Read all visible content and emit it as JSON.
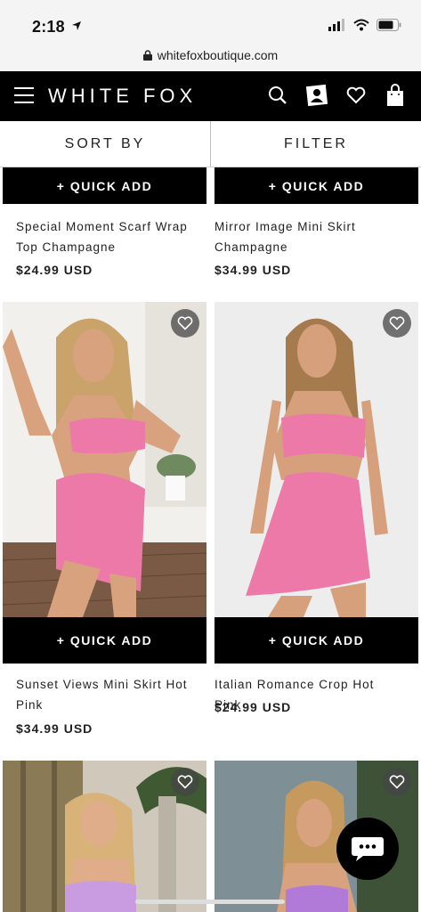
{
  "status": {
    "time": "2:18"
  },
  "browser": {
    "url": "whitefoxboutique.com"
  },
  "header": {
    "brand": "WHITE FOX"
  },
  "toolbar": {
    "sort_label": "SORT BY",
    "filter_label": "FILTER"
  },
  "quick_add_label": "+ QUICK ADD",
  "products": [
    {
      "title": "Special Moment Scarf Wrap Top Champagne",
      "price": "$24.99 USD"
    },
    {
      "title": "Mirror Image Mini Skirt Champagne",
      "price": "$34.99 USD"
    },
    {
      "title": "Sunset Views Mini Skirt Hot Pink",
      "price": "$34.99 USD"
    },
    {
      "title": "Italian Romance Crop Hot Pink",
      "price": "$24.99 USD"
    }
  ],
  "colors": {
    "header_bg": "#000000",
    "pink": "#ec79a8",
    "lilac": "#c99be0"
  }
}
